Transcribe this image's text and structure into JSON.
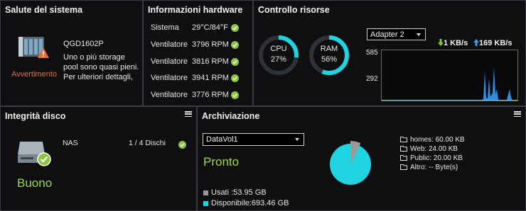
{
  "health": {
    "title": "Salute del sistema",
    "device_name": "QGD1602P",
    "message": "Uno o più storage pool sono quasi pieni. Per ulteriori dettagli,",
    "status": "Avvertimento",
    "status_color": "#e0703a"
  },
  "hardware": {
    "title": "Informazioni hardware",
    "rows": [
      {
        "label": "Sistema",
        "value": "29°C/84°F"
      },
      {
        "label": "Ventilatore",
        "value": "3796 RPM"
      },
      {
        "label": "Ventilatore",
        "value": "3816 RPM"
      },
      {
        "label": "Ventilatore",
        "value": "3941 RPM"
      },
      {
        "label": "Ventilatore",
        "value": "3776 RPM"
      }
    ]
  },
  "resources": {
    "title": "Controllo risorse",
    "cpu": {
      "label": "CPU",
      "percent_text": "27%",
      "percent": 27
    },
    "ram": {
      "label": "RAM",
      "percent_text": "56%",
      "percent": 56
    },
    "adapter": "Adapter 2",
    "download": "1 KB/s",
    "upload": "169 KB/s",
    "graph_ticks": [
      "585",
      "292"
    ],
    "ring_color": "#1fd4e0",
    "download_color": "#7ccf3e",
    "upload_color": "#3a9ee8"
  },
  "disk": {
    "title": "Integrità disco",
    "name": "NAS",
    "count": "1 / 4 Dischi",
    "status": "Buono",
    "status_color": "#9fd84a"
  },
  "storage": {
    "title": "Archiviazione",
    "volume": "DataVol1",
    "status": "Pronto",
    "used": "Usati :53.95 GB",
    "available": "Disponibile:693.46 GB",
    "used_fraction": 0.072,
    "used_color": "#9a9a9a",
    "free_color": "#1fd4e0",
    "folders": [
      "homes: 60.00 KB",
      "Web: 24.00 KB",
      "Public: 20.00 KB",
      "Altro: -- Byte(s)"
    ]
  }
}
